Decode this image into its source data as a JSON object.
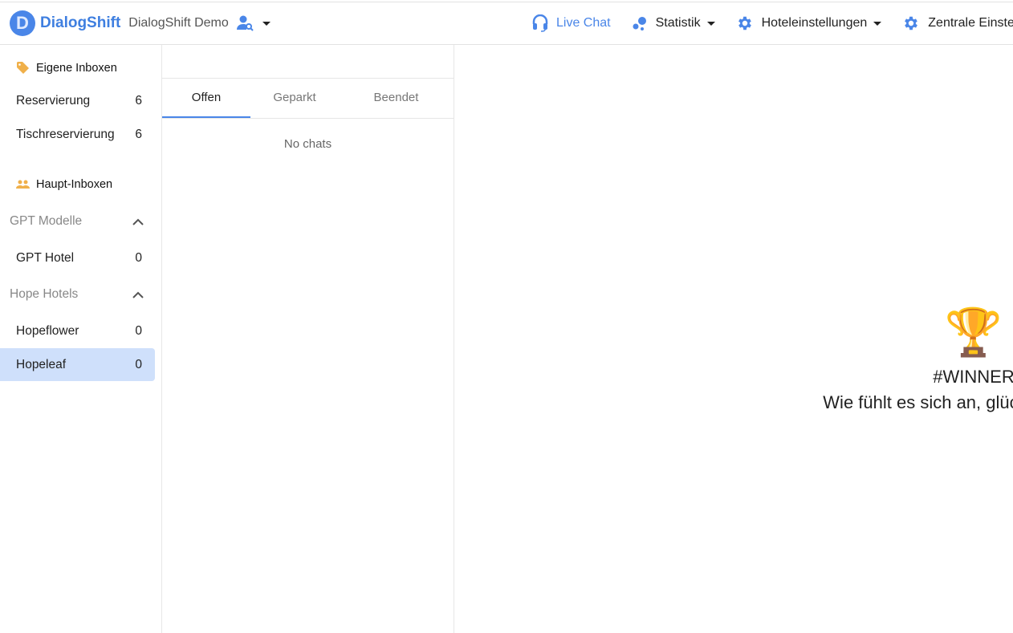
{
  "header": {
    "logo_letter": "D",
    "brand": "DialogShift",
    "org": "DialogShift Demo",
    "nav": [
      {
        "label": "Live Chat",
        "icon": "headset-icon",
        "active": true
      },
      {
        "label": "Statistik",
        "icon": "stats-icon"
      },
      {
        "label": "Hoteleinstellungen",
        "icon": "gear-icon"
      },
      {
        "label": "Zentrale Einstellungen",
        "icon": "gear-icon"
      }
    ]
  },
  "sidebar": {
    "own": {
      "title": "Eigene Inboxen",
      "items": [
        {
          "label": "Reservierung",
          "count": "6"
        },
        {
          "label": "Tischreservierung",
          "count": "6"
        }
      ]
    },
    "main": {
      "title": "Haupt-Inboxen"
    },
    "groups": [
      {
        "label": "GPT Modelle",
        "items": [
          {
            "label": "GPT Hotel",
            "count": "0"
          }
        ]
      },
      {
        "label": "Hope Hotels",
        "items": [
          {
            "label": "Hopeflower",
            "count": "0"
          },
          {
            "label": "Hopeleaf",
            "count": "0"
          }
        ]
      }
    ]
  },
  "list": {
    "tabs": [
      "Offen",
      "Geparkt",
      "Beendet"
    ],
    "empty": "No chats"
  },
  "main": {
    "emoji": "🏆",
    "title": "#WINNER",
    "subtitle": "Wie fühlt es sich an, glücklich zu sein?"
  },
  "colors": {
    "accent": "#4a86e8",
    "active_row": "#cfe0fb"
  }
}
